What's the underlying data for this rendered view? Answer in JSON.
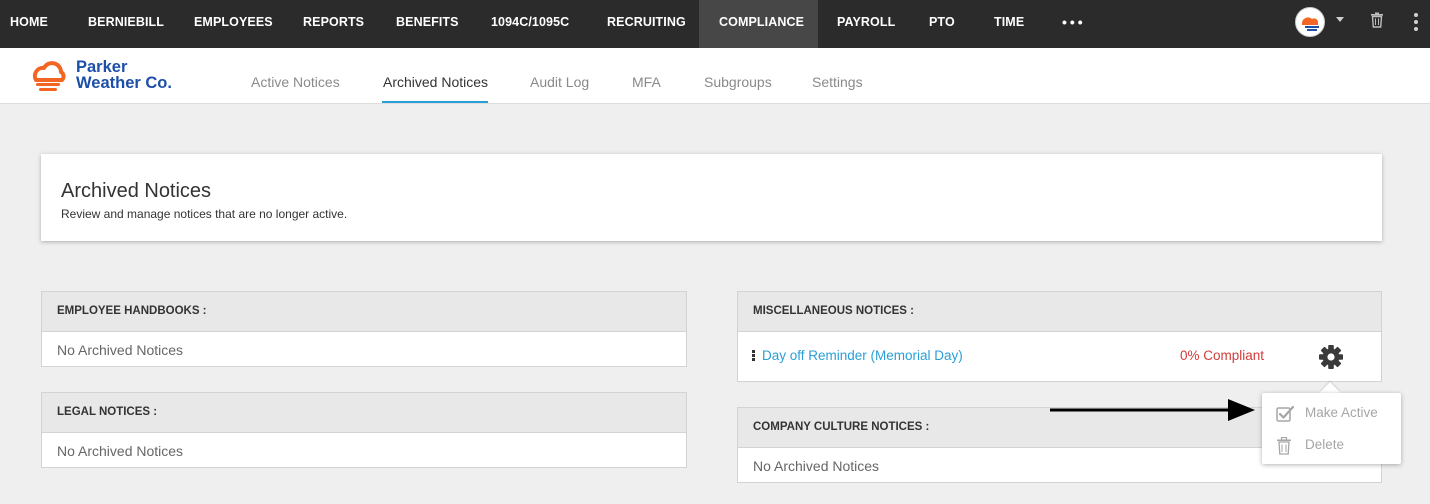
{
  "top_nav": {
    "items": [
      "HOME",
      "BERNIEBILL",
      "EMPLOYEES",
      "REPORTS",
      "BENEFITS",
      "1094C/1095C",
      "RECRUITING",
      "COMPLIANCE",
      "PAYROLL",
      "PTO",
      "TIME"
    ],
    "active": "COMPLIANCE",
    "more_label": "•••"
  },
  "brand": {
    "line1": "Parker",
    "line2": "Weather Co.",
    "color": "#1e4fa8",
    "accent": "#f26522"
  },
  "tabs": [
    "Active Notices",
    "Archived Notices",
    "Audit Log",
    "MFA",
    "Subgroups",
    "Settings"
  ],
  "active_tab": "Archived Notices",
  "header": {
    "title": "Archived Notices",
    "subtitle": "Review and manage notices that are no longer active."
  },
  "panels": {
    "employee_handbooks": {
      "title": "EMPLOYEE HANDBOOKS :",
      "empty": "No Archived Notices"
    },
    "legal_notices": {
      "title": "LEGAL NOTICES :",
      "empty": "No Archived Notices"
    },
    "misc_notices": {
      "title": "MISCELLANEOUS NOTICES :",
      "items": [
        {
          "name": "Day off Reminder (Memorial Day)",
          "status": "0% Compliant"
        }
      ]
    },
    "company_culture": {
      "title": "COMPANY CULTURE NOTICES :",
      "empty": "No Archived Notices"
    }
  },
  "menu": {
    "make_active": "Make Active",
    "delete": "Delete"
  },
  "colors": {
    "link": "#2a9fd6",
    "danger": "#d23b3b",
    "nav_bg": "#2b2b2b",
    "nav_active": "#474747"
  }
}
